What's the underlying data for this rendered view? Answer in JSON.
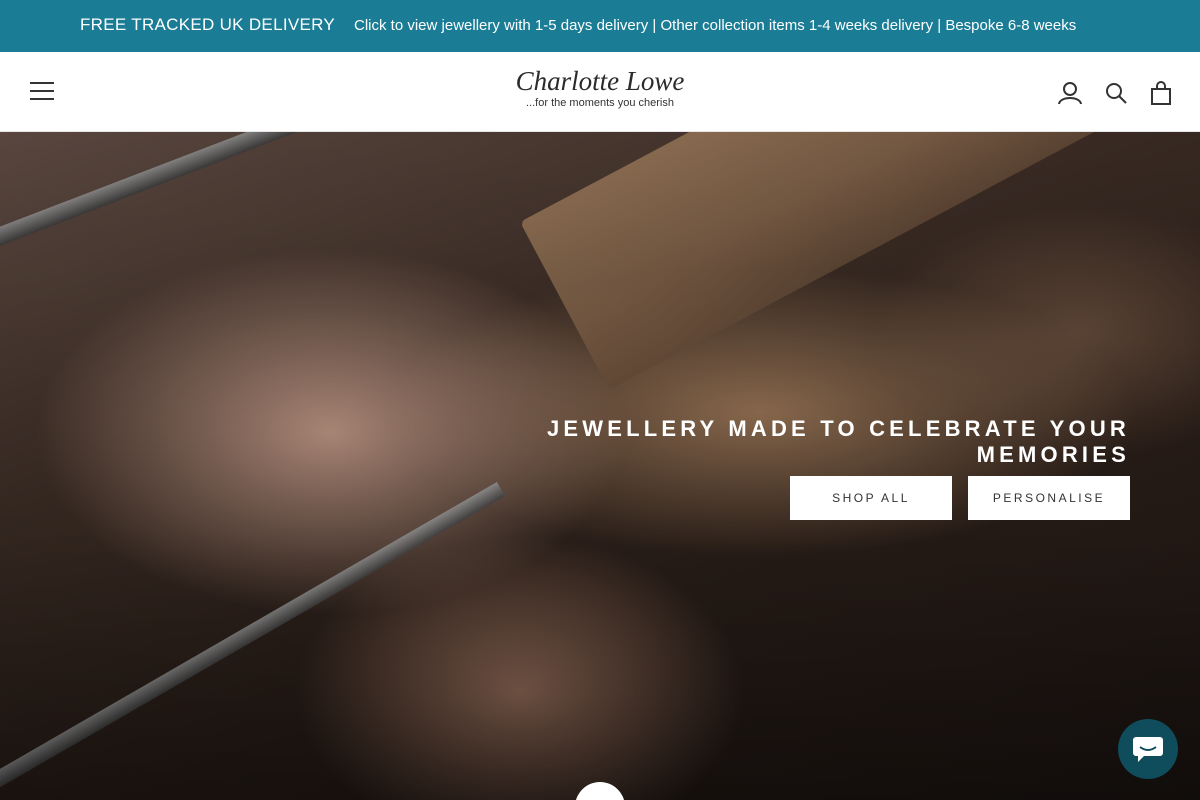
{
  "announcement": {
    "headline": "FREE TRACKED UK DELIVERY",
    "details": "Click to view jewellery with 1-5 days delivery | Other collection items 1-4 weeks delivery | Bespoke 6-8 weeks",
    "background_color": "#1a7d95"
  },
  "header": {
    "logo": {
      "brand": "Charlotte Lowe",
      "tagline": "...for the moments you cherish"
    },
    "icons": [
      "menu-icon",
      "account-icon",
      "search-icon",
      "cart-icon"
    ]
  },
  "hero": {
    "title": "JEWELLERY MADE TO CELEBRATE YOUR MEMORIES",
    "buttons": {
      "shop_all": "SHOP ALL",
      "personalise": "PERSONALISE"
    }
  },
  "chat": {
    "icon": "chat-icon",
    "color": "#0f4c5c"
  }
}
